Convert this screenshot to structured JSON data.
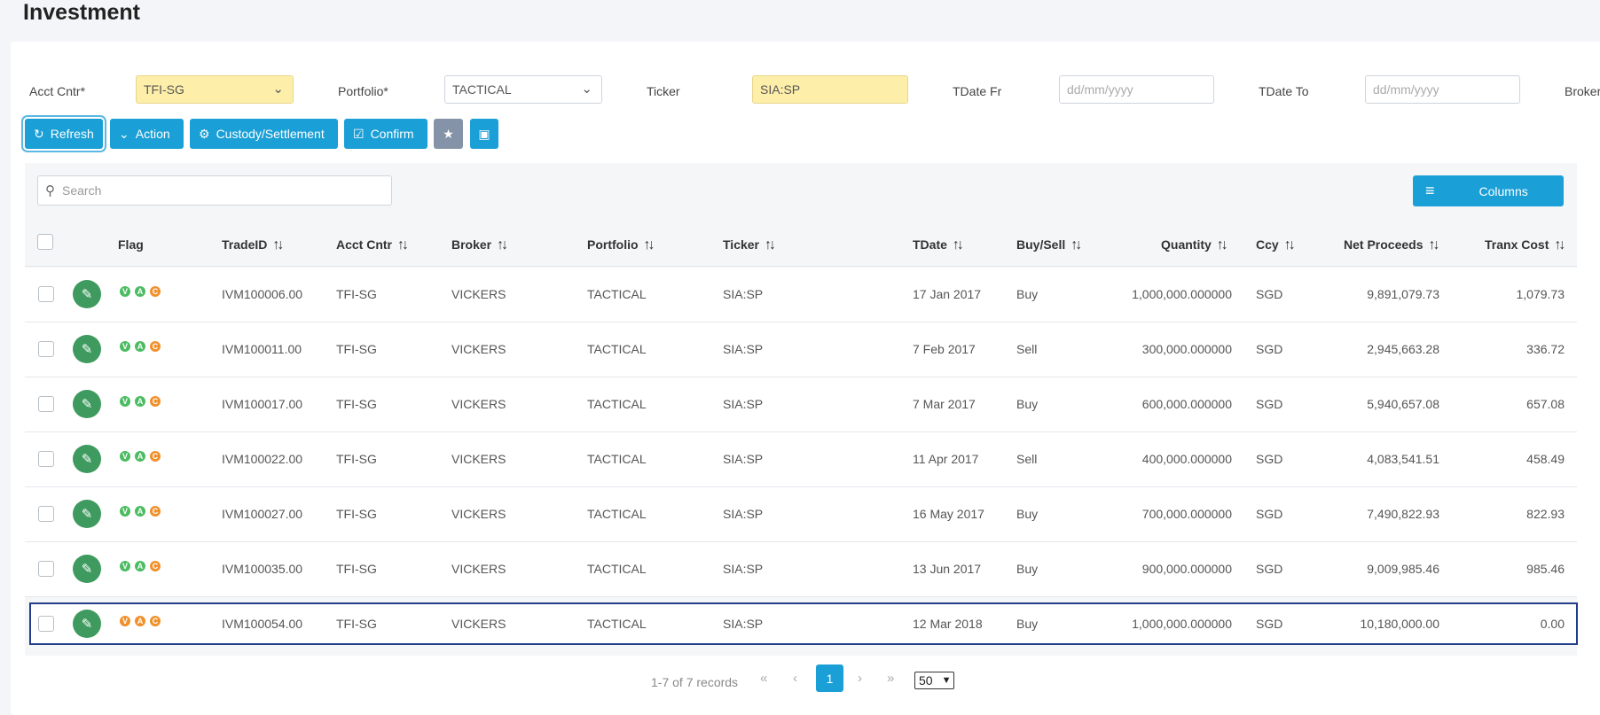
{
  "page": {
    "title": "Investment"
  },
  "filters": {
    "acct_cntr_label": "Acct Cntr*",
    "acct_cntr_value": "TFI-SG",
    "portfolio_label": "Portfolio*",
    "portfolio_value": "TACTICAL",
    "ticker_label": "Ticker",
    "ticker_value": "SIA:SP",
    "tdate_fr_label": "TDate Fr",
    "tdate_fr_placeholder": "dd/mm/yyyy",
    "tdate_to_label": "TDate To",
    "tdate_to_placeholder": "dd/mm/yyyy",
    "broker_label": "Broker"
  },
  "toolbar": {
    "refresh_label": "Refresh",
    "action_label": "Action",
    "custody_label": "Custody/Settlement",
    "confirm_label": "Confirm"
  },
  "grid": {
    "search_placeholder": "Search",
    "columns_label": "Columns",
    "headers": {
      "flag": "Flag",
      "tradeid": "TradeID",
      "acct": "Acct Cntr",
      "broker": "Broker",
      "portfolio": "Portfolio",
      "ticker": "Ticker",
      "tdate": "TDate",
      "buysell": "Buy/Sell",
      "quantity": "Quantity",
      "ccy": "Ccy",
      "net": "Net Proceeds",
      "tranx": "Tranx Cost"
    },
    "rows": [
      {
        "flags": [
          "V",
          "A",
          "C"
        ],
        "flag_colors": [
          "green",
          "green",
          "orange"
        ],
        "tradeid": "IVM100006.00",
        "acct": "TFI-SG",
        "broker": "VICKERS",
        "portfolio": "TACTICAL",
        "ticker": "SIA:SP",
        "tdate": "17 Jan 2017",
        "buysell": "Buy",
        "quantity": "1,000,000.000000",
        "ccy": "SGD",
        "net": "9,891,079.73",
        "tranx": "1,079.73"
      },
      {
        "flags": [
          "V",
          "A",
          "C"
        ],
        "flag_colors": [
          "green",
          "green",
          "orange"
        ],
        "tradeid": "IVM100011.00",
        "acct": "TFI-SG",
        "broker": "VICKERS",
        "portfolio": "TACTICAL",
        "ticker": "SIA:SP",
        "tdate": "7 Feb 2017",
        "buysell": "Sell",
        "quantity": "300,000.000000",
        "ccy": "SGD",
        "net": "2,945,663.28",
        "tranx": "336.72"
      },
      {
        "flags": [
          "V",
          "A",
          "C"
        ],
        "flag_colors": [
          "green",
          "green",
          "orange"
        ],
        "tradeid": "IVM100017.00",
        "acct": "TFI-SG",
        "broker": "VICKERS",
        "portfolio": "TACTICAL",
        "ticker": "SIA:SP",
        "tdate": "7 Mar 2017",
        "buysell": "Buy",
        "quantity": "600,000.000000",
        "ccy": "SGD",
        "net": "5,940,657.08",
        "tranx": "657.08"
      },
      {
        "flags": [
          "V",
          "A",
          "C"
        ],
        "flag_colors": [
          "green",
          "green",
          "orange"
        ],
        "tradeid": "IVM100022.00",
        "acct": "TFI-SG",
        "broker": "VICKERS",
        "portfolio": "TACTICAL",
        "ticker": "SIA:SP",
        "tdate": "11 Apr 2017",
        "buysell": "Sell",
        "quantity": "400,000.000000",
        "ccy": "SGD",
        "net": "4,083,541.51",
        "tranx": "458.49"
      },
      {
        "flags": [
          "V",
          "A",
          "C"
        ],
        "flag_colors": [
          "green",
          "green",
          "orange"
        ],
        "tradeid": "IVM100027.00",
        "acct": "TFI-SG",
        "broker": "VICKERS",
        "portfolio": "TACTICAL",
        "ticker": "SIA:SP",
        "tdate": "16 May 2017",
        "buysell": "Buy",
        "quantity": "700,000.000000",
        "ccy": "SGD",
        "net": "7,490,822.93",
        "tranx": "822.93"
      },
      {
        "flags": [
          "V",
          "A",
          "C"
        ],
        "flag_colors": [
          "green",
          "green",
          "orange"
        ],
        "tradeid": "IVM100035.00",
        "acct": "TFI-SG",
        "broker": "VICKERS",
        "portfolio": "TACTICAL",
        "ticker": "SIA:SP",
        "tdate": "13 Jun 2017",
        "buysell": "Buy",
        "quantity": "900,000.000000",
        "ccy": "SGD",
        "net": "9,009,985.46",
        "tranx": "985.46"
      },
      {
        "flags": [
          "V",
          "A",
          "C"
        ],
        "flag_colors": [
          "orange",
          "orange",
          "orange"
        ],
        "tradeid": "IVM100054.00",
        "acct": "TFI-SG",
        "broker": "VICKERS",
        "portfolio": "TACTICAL",
        "ticker": "SIA:SP",
        "tdate": "12 Mar 2018",
        "buysell": "Buy",
        "quantity": "1,000,000.000000",
        "ccy": "SGD",
        "net": "10,180,000.00",
        "tranx": "0.00"
      }
    ]
  },
  "pagination": {
    "info": "1-7 of 7 records",
    "current_page": "1",
    "page_size": "50"
  },
  "colors": {
    "accent": "#1a9fd6",
    "edit": "#3e9a5e",
    "highlight": "#fdefa9",
    "selection": "#223e8a"
  }
}
